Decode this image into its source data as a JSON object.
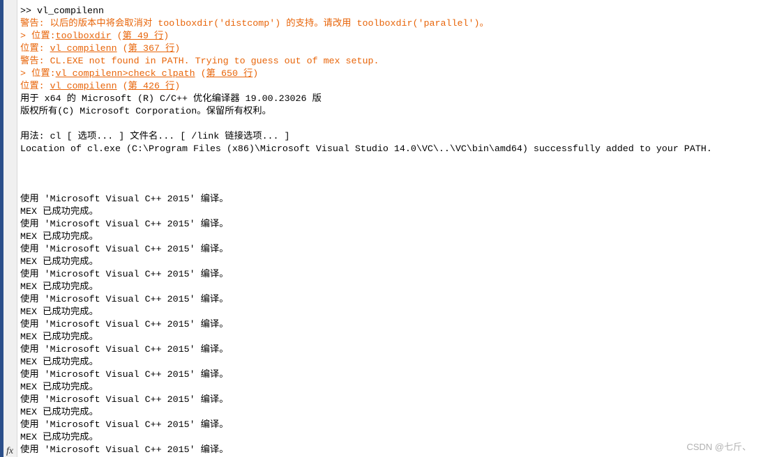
{
  "accent_colors": {
    "warning": "#e8650a",
    "text": "#000000"
  },
  "prompt_icon": "fx-icon",
  "watermark": "CSDN @七斤、",
  "lines": [
    {
      "kind": "normal",
      "segments": [
        {
          "t": ">> vl_compilenn"
        }
      ]
    },
    {
      "kind": "warn",
      "segments": [
        {
          "t": "警告: 以后的版本中将会取消对 toolboxdir('distcomp') 的支持。请改用 toolboxdir('parallel')。"
        }
      ]
    },
    {
      "kind": "warn",
      "segments": [
        {
          "t": "> 位置:"
        },
        {
          "t": "toolboxdir",
          "link": true
        },
        {
          "t": " ("
        },
        {
          "t": "第 49 行",
          "link": true
        },
        {
          "t": ")"
        }
      ]
    },
    {
      "kind": "warn",
      "segments": [
        {
          "t": "位置: "
        },
        {
          "t": "vl_compilenn",
          "link": true
        },
        {
          "t": " ("
        },
        {
          "t": "第 367 行",
          "link": true
        },
        {
          "t": ")"
        }
      ]
    },
    {
      "kind": "warn",
      "segments": [
        {
          "t": "警告: CL.EXE not found in PATH. Trying to guess out of mex setup."
        }
      ]
    },
    {
      "kind": "warn",
      "segments": [
        {
          "t": "> 位置:"
        },
        {
          "t": "vl_compilenn>check_clpath",
          "link": true
        },
        {
          "t": " ("
        },
        {
          "t": "第 650 行",
          "link": true
        },
        {
          "t": ")"
        }
      ]
    },
    {
      "kind": "warn",
      "segments": [
        {
          "t": "位置: "
        },
        {
          "t": "vl_compilenn",
          "link": true
        },
        {
          "t": " ("
        },
        {
          "t": "第 426 行",
          "link": true
        },
        {
          "t": ")"
        }
      ]
    },
    {
      "kind": "normal",
      "segments": [
        {
          "t": "用于 x64 的 Microsoft (R) C/C++ 优化编译器 19.00.23026 版"
        }
      ]
    },
    {
      "kind": "normal",
      "segments": [
        {
          "t": "版权所有(C) Microsoft Corporation。保留所有权利。"
        }
      ]
    },
    {
      "kind": "normal",
      "segments": [
        {
          "t": ""
        }
      ]
    },
    {
      "kind": "normal",
      "segments": [
        {
          "t": "用法: cl [ 选项... ] 文件名... [ /link 链接选项... ]"
        }
      ]
    },
    {
      "kind": "normal",
      "segments": [
        {
          "t": "Location of cl.exe (C:\\Program Files (x86)\\Microsoft Visual Studio 14.0\\VC\\..\\VC\\bin\\amd64) successfully added to your PATH."
        }
      ]
    },
    {
      "kind": "normal",
      "segments": [
        {
          "t": ""
        }
      ]
    },
    {
      "kind": "normal",
      "segments": [
        {
          "t": ""
        }
      ]
    },
    {
      "kind": "normal",
      "segments": [
        {
          "t": ""
        }
      ]
    },
    {
      "kind": "normal",
      "segments": [
        {
          "t": "使用 'Microsoft Visual C++ 2015' 编译。"
        }
      ]
    },
    {
      "kind": "normal",
      "segments": [
        {
          "t": "MEX 已成功完成。"
        }
      ]
    },
    {
      "kind": "normal",
      "segments": [
        {
          "t": "使用 'Microsoft Visual C++ 2015' 编译。"
        }
      ]
    },
    {
      "kind": "normal",
      "segments": [
        {
          "t": "MEX 已成功完成。"
        }
      ]
    },
    {
      "kind": "normal",
      "segments": [
        {
          "t": "使用 'Microsoft Visual C++ 2015' 编译。"
        }
      ]
    },
    {
      "kind": "normal",
      "segments": [
        {
          "t": "MEX 已成功完成。"
        }
      ]
    },
    {
      "kind": "normal",
      "segments": [
        {
          "t": "使用 'Microsoft Visual C++ 2015' 编译。"
        }
      ]
    },
    {
      "kind": "normal",
      "segments": [
        {
          "t": "MEX 已成功完成。"
        }
      ]
    },
    {
      "kind": "normal",
      "segments": [
        {
          "t": "使用 'Microsoft Visual C++ 2015' 编译。"
        }
      ]
    },
    {
      "kind": "normal",
      "segments": [
        {
          "t": "MEX 已成功完成。"
        }
      ]
    },
    {
      "kind": "normal",
      "segments": [
        {
          "t": "使用 'Microsoft Visual C++ 2015' 编译。"
        }
      ]
    },
    {
      "kind": "normal",
      "segments": [
        {
          "t": "MEX 已成功完成。"
        }
      ]
    },
    {
      "kind": "normal",
      "segments": [
        {
          "t": "使用 'Microsoft Visual C++ 2015' 编译。"
        }
      ]
    },
    {
      "kind": "normal",
      "segments": [
        {
          "t": "MEX 已成功完成。"
        }
      ]
    },
    {
      "kind": "normal",
      "segments": [
        {
          "t": "使用 'Microsoft Visual C++ 2015' 编译。"
        }
      ]
    },
    {
      "kind": "normal",
      "segments": [
        {
          "t": "MEX 已成功完成。"
        }
      ]
    },
    {
      "kind": "normal",
      "segments": [
        {
          "t": "使用 'Microsoft Visual C++ 2015' 编译。"
        }
      ]
    },
    {
      "kind": "normal",
      "segments": [
        {
          "t": "MEX 已成功完成。"
        }
      ]
    },
    {
      "kind": "normal",
      "segments": [
        {
          "t": "使用 'Microsoft Visual C++ 2015' 编译。"
        }
      ]
    },
    {
      "kind": "normal",
      "segments": [
        {
          "t": "MEX 已成功完成。"
        }
      ]
    },
    {
      "kind": "normal",
      "segments": [
        {
          "t": "使用 'Microsoft Visual C++ 2015' 编译。"
        }
      ]
    }
  ]
}
